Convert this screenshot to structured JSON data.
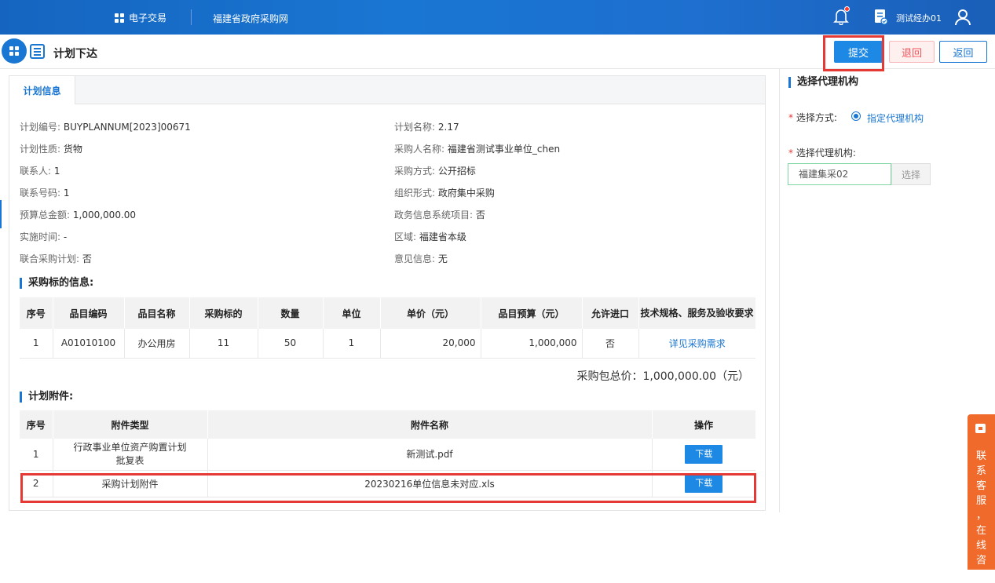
{
  "topbar": {
    "nav_trade": "电子交易",
    "nav_site": "福建省政府采购网",
    "user_name": "测试经办01"
  },
  "header": {
    "page_title": "计划下达",
    "submit_label": "提交",
    "reject_label": "退回",
    "return_label": "返回"
  },
  "tab": {
    "label": "计划信息"
  },
  "plan_info": {
    "left": [
      {
        "label": "计划编号:",
        "value": "BUYPLANNUM[2023]00671"
      },
      {
        "label": "计划性质:",
        "value": "货物"
      },
      {
        "label": "联系人:",
        "value": "1"
      },
      {
        "label": "联系号码:",
        "value": "1"
      },
      {
        "label": "预算总金额:",
        "value": "1,000,000.00"
      },
      {
        "label": "实施时间:",
        "value": "-"
      },
      {
        "label": "联合采购计划:",
        "value": "否"
      }
    ],
    "right": [
      {
        "label": "计划名称:",
        "value": "2.17"
      },
      {
        "label": "采购人名称:",
        "value": "福建省测试事业单位_chen"
      },
      {
        "label": "采购方式:",
        "value": "公开招标"
      },
      {
        "label": "组织形式:",
        "value": "政府集中采购"
      },
      {
        "label": "政务信息系统项目:",
        "value": "否"
      },
      {
        "label": "区域:",
        "value": "福建省本级"
      },
      {
        "label": "意见信息:",
        "value": "无"
      }
    ]
  },
  "targets": {
    "title": "采购标的信息:",
    "headers": [
      "序号",
      "品目编码",
      "品目名称",
      "采购标的",
      "数量",
      "单位",
      "单价（元）",
      "品目预算（元）",
      "允许进口",
      "技术规格、服务及验收要求"
    ],
    "rows": [
      [
        "1",
        "A01010100",
        "办公用房",
        "11",
        "50",
        "1",
        "20,000",
        "1,000,000",
        "否",
        "详见采购需求"
      ]
    ],
    "total": "采购包总价：1,000,000.00（元）"
  },
  "attachments": {
    "title": "计划附件:",
    "headers": [
      "序号",
      "附件类型",
      "附件名称",
      "操作"
    ],
    "rows": [
      {
        "no": "1",
        "type": "行政事业单位资产购置计划批复表",
        "name": "新测试.pdf",
        "action": "下载"
      },
      {
        "no": "2",
        "type": "采购计划附件",
        "name": "20230216单位信息未对应.xls",
        "action": "下载"
      }
    ]
  },
  "agency": {
    "title": "选择代理机构",
    "method_label": "选择方式:",
    "method_option": "指定代理机构",
    "agency_label": "选择代理机构:",
    "agency_value": "福建集采02",
    "select_label": "选择"
  },
  "service": {
    "text": "联系客服，在线咨询"
  },
  "colors": {
    "primary": "#1976d2",
    "highlight": "#e53935",
    "service": "#f06a2c"
  }
}
